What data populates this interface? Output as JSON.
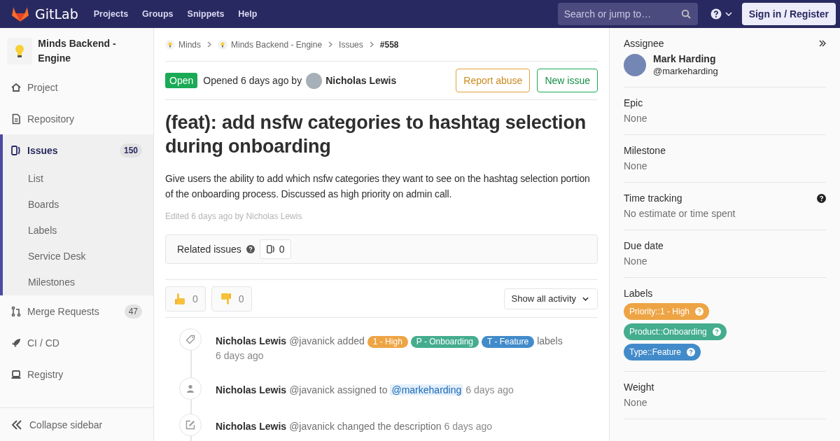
{
  "navbar": {
    "brand": "GitLab",
    "links": [
      "Projects",
      "Groups",
      "Snippets",
      "Help"
    ],
    "search": {
      "placeholder": "Search or jump to…"
    },
    "sign_in": "Sign in / Register"
  },
  "sidebar": {
    "project": "Minds Backend - Engine",
    "items": [
      {
        "label": "Project",
        "kind": "home",
        "selected": false
      },
      {
        "label": "Repository",
        "kind": "doc",
        "selected": false
      },
      {
        "label": "Issues",
        "kind": "issues",
        "selected": true,
        "count": "150",
        "children": [
          {
            "label": "List",
            "selected": false
          },
          {
            "label": "Boards",
            "selected": false
          },
          {
            "label": "Labels",
            "selected": false
          },
          {
            "label": "Service Desk",
            "selected": false
          },
          {
            "label": "Milestones",
            "selected": false
          }
        ]
      },
      {
        "label": "Merge Requests",
        "kind": "merge",
        "selected": false,
        "count": "47"
      },
      {
        "label": "CI / CD",
        "kind": "rocket",
        "selected": false
      },
      {
        "label": "Registry",
        "kind": "registry",
        "selected": false
      }
    ],
    "collapse": "Collapse sidebar"
  },
  "breadcrumbs": [
    {
      "label": "Minds",
      "kind": "project"
    },
    {
      "label": "Minds Backend - Engine",
      "kind": "project"
    },
    {
      "label": "Issues",
      "kind": "link"
    },
    {
      "label": "#558",
      "kind": "current"
    }
  ],
  "issue": {
    "status": "Open",
    "opened": "Opened 6 days ago by",
    "author": "Nicholas Lewis",
    "actions": [
      {
        "label": "Report abuse",
        "kind": "warning"
      },
      {
        "label": "New issue",
        "kind": "success"
      }
    ],
    "title": "(feat): add nsfw categories to hashtag selection during onboarding",
    "description": "Give users the ability to add which nsfw categories they want to see on the hashtag selection portion of the onboarding process. Discussed as high priority on admin call.",
    "edited": "Edited 6 days ago by Nicholas Lewis",
    "related": {
      "label": "Related issues",
      "count": "0"
    },
    "reactions": [
      {
        "kind": "thumbsup",
        "count": "0"
      },
      {
        "kind": "thumbsdown",
        "count": "0"
      }
    ],
    "activity_filter": "Show all activity"
  },
  "activity": [
    {
      "kind": "labels",
      "author": "Nicholas Lewis",
      "handle": "@javanick",
      "action": "added",
      "labels": [
        {
          "text": "1 - High",
          "color": "#eea444"
        },
        {
          "text": "P - Onboarding",
          "color": "#44ad8e"
        },
        {
          "text": "T - Feature",
          "color": "#428bca"
        }
      ],
      "suffix": "labels",
      "time": "6 days ago"
    },
    {
      "kind": "assigned",
      "author": "Nicholas Lewis",
      "handle": "@javanick",
      "action": "assigned to",
      "mention": "@markeharding",
      "time": "6 days ago"
    },
    {
      "kind": "description",
      "author": "Nicholas Lewis",
      "handle": "@javanick",
      "action": "changed the description",
      "time": "6 days ago"
    }
  ],
  "right_sidebar": {
    "assignee": {
      "heading": "Assignee",
      "name": "Mark Harding",
      "username": "@markeharding"
    },
    "blocks": [
      {
        "kind": "plain",
        "heading": "Epic",
        "value": "None"
      },
      {
        "kind": "plain",
        "heading": "Milestone",
        "value": "None"
      },
      {
        "kind": "help",
        "heading": "Time tracking",
        "value": "No estimate or time spent"
      },
      {
        "kind": "plain",
        "heading": "Due date",
        "value": "None"
      },
      {
        "kind": "labels",
        "heading": "Labels",
        "labels": [
          {
            "text": "Priority::1 - High",
            "color": "#eea444"
          },
          {
            "text": "Product::Onboarding",
            "color": "#44ad8e"
          },
          {
            "text": "Type::Feature",
            "color": "#428bca"
          }
        ]
      },
      {
        "kind": "plain",
        "heading": "Weight",
        "value": "None"
      }
    ]
  }
}
